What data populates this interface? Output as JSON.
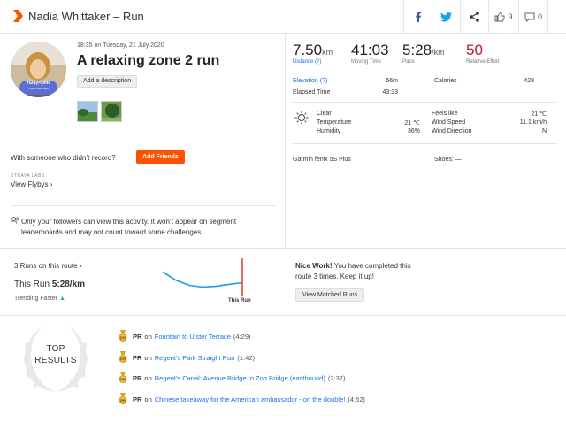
{
  "header": {
    "title": "Nadia Whittaker – Run",
    "kudos_count": "9",
    "comment_count": "0"
  },
  "activity": {
    "datetime": "18:35 on Tuesday, 21 July 2020",
    "title": "A relaxing zone 2 run",
    "add_description": "Add a description",
    "avatar_badge_1": "#StayHome",
    "avatar_badge_2": "I could save lives"
  },
  "social": {
    "someone_text": "With someone who didn’t record?",
    "add_friends": "Add Friends",
    "strava_labs": "STRAVA LABS",
    "view_flybys": "View Flybys",
    "privacy_text": "Only your followers can view this activity. It won’t appear on segment leaderboards and may not count toward some challenges."
  },
  "stats": {
    "distance_value": "7.50",
    "distance_unit": "km",
    "distance_label": "Distance (?)",
    "moving_time_value": "41:03",
    "moving_time_label": "Moving Time",
    "pace_value": "5:28",
    "pace_unit": "/km",
    "pace_label": "Pace",
    "relative_effort_value": "50",
    "relative_effort_label": "Relative Effort",
    "elevation_label": "Elevation (?)",
    "elevation_value": "56m",
    "calories_label": "Calories",
    "calories_value": "428",
    "elapsed_label": "Elapsed Time",
    "elapsed_value": "43:33"
  },
  "weather": {
    "condition": "Clear",
    "temperature_label": "Temperature",
    "temperature_value": "21 ℃",
    "humidity_label": "Humidity",
    "humidity_value": "36%",
    "feels_like_label": "Feels like",
    "feels_like_value": "21 ℃",
    "wind_speed_label": "Wind Speed",
    "wind_speed_value": "11.1 km/h",
    "wind_direction_label": "Wind Direction",
    "wind_direction_value": "N"
  },
  "gear": {
    "device": "Garmin fēnix 5S Plus",
    "shoes": "Shoes: —"
  },
  "route": {
    "runs_on_route": "3 Runs on this route",
    "this_run_label": "This Run",
    "this_run_value": "5:28/km",
    "trending": "Trending Faster",
    "this_run_tag": "This Run",
    "nice_work_bold": "Nice Work!",
    "nice_work_text": " You have completed this route 3 times. Keep it up!",
    "view_matched": "View Matched Runs",
    "trend_values": [
      0.65,
      0.4,
      0.25,
      0.2,
      0.22,
      0.28,
      0.33
    ]
  },
  "top_results": {
    "title_line1": "TOP",
    "title_line2": "RESULTS",
    "items": [
      {
        "pr": "PR",
        "on": "on",
        "segment": "Fountain to Ulster Terrace",
        "time": "(4:29)"
      },
      {
        "pr": "PR",
        "on": "on",
        "segment": "Regent's Park Straight Run",
        "time": "(1:42)"
      },
      {
        "pr": "PR",
        "on": "on",
        "segment": "Regent's Canal: Avenue Bridge to Zoo Bridge (eastbound)",
        "time": "(2:37)"
      },
      {
        "pr": "PR",
        "on": "on",
        "segment": "Chinese takeaway for the American ambassador - on the double!",
        "time": "(4:52)"
      }
    ]
  },
  "colors": {
    "brand": "#fc5200",
    "link": "#1a73e8",
    "relative_effort": "#c8102e",
    "chart_line": "#1f9de0",
    "this_run_marker": "#e0301e",
    "trend_arrow": "#2bb673",
    "medal": "#d9a520"
  }
}
